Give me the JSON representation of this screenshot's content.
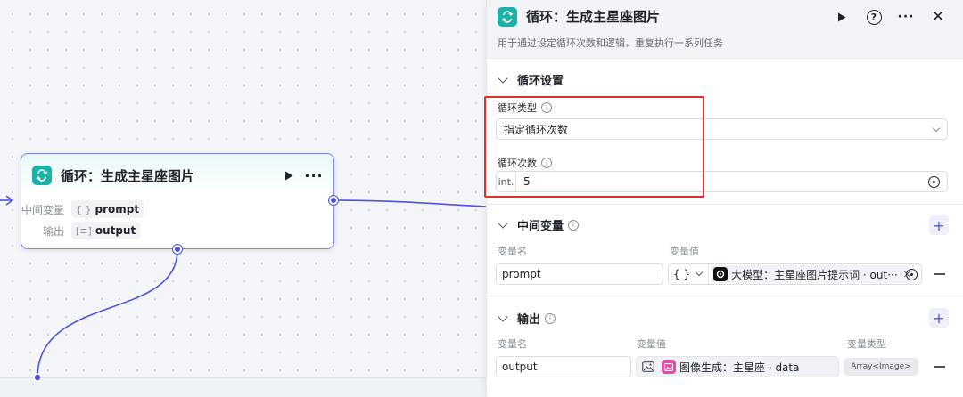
{
  "node": {
    "title": "循环：生成主星座图片",
    "rows": [
      {
        "label": "中间变量",
        "type_icon": "{ }",
        "value": "prompt"
      },
      {
        "label": "输出",
        "type_icon": "[≡]",
        "value": "output"
      }
    ]
  },
  "panel": {
    "title": "循环：生成主星座图片",
    "description": "用于通过设定循环次数和逻辑，重复执行一系列任务",
    "loop_settings": {
      "title": "循环设置",
      "loop_type_label": "循环类型",
      "loop_type_value": "指定循环次数",
      "loop_count_label": "循环次数",
      "loop_count_prefix": "int.",
      "loop_count_value": "5"
    },
    "variables": {
      "title": "中间变量",
      "col_name": "变量名",
      "col_value": "变量值",
      "rows": [
        {
          "name": "prompt",
          "type": "{ }",
          "ref": "大模型：主星座图片提示词 · out···"
        }
      ]
    },
    "outputs": {
      "title": "输出",
      "col_name": "变量名",
      "col_value": "变量值",
      "col_type": "变量类型",
      "rows": [
        {
          "name": "output",
          "ref": "图像生成：主星座 · data",
          "type": "Array<Image>"
        }
      ]
    }
  },
  "colors": {
    "accent": "#4c55d9",
    "loop_badge": "#1db2a8",
    "highlight": "#e03131",
    "image_node": "#e44ba6"
  }
}
